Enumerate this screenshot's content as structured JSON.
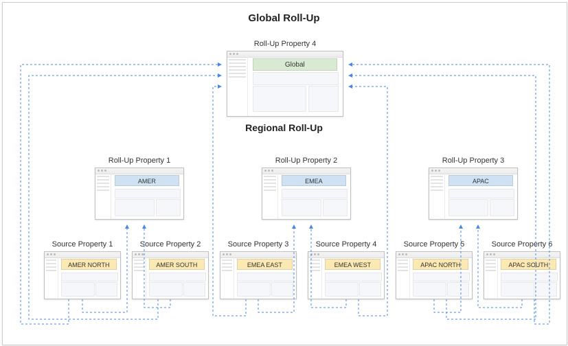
{
  "titles": {
    "global": "Global Roll-Up",
    "regional": "Regional Roll-Up"
  },
  "labels": {
    "rp1": "Roll-Up Property 1",
    "rp2": "Roll-Up Property 2",
    "rp3": "Roll-Up Property 3",
    "rp4": "Roll-Up Property 4",
    "sp1": "Source Property 1",
    "sp2": "Source Property 2",
    "sp3": "Source Property 3",
    "sp4": "Source Property 4",
    "sp5": "Source Property 5",
    "sp6": "Source Property 6"
  },
  "banners": {
    "global": "Global",
    "amer": "AMER",
    "emea": "EMEA",
    "apac": "APAC",
    "amer_north": "AMER NORTH",
    "amer_south": "AMER SOUTH",
    "emea_east": "EMEA EAST",
    "emea_west": "EMEA WEST",
    "apac_north": "APAC NORTH",
    "apac_south": "APAC SOUTH"
  },
  "colors": {
    "connector": "#4a86e8",
    "banner_global": "#d8ead3",
    "banner_region": "#cfe2f3",
    "banner_source": "#fce8b2"
  },
  "chart_data": {
    "type": "diagram",
    "nodes": [
      {
        "id": "rp4",
        "tier": "global",
        "label": "Roll-Up Property 4",
        "banner": "Global"
      },
      {
        "id": "rp1",
        "tier": "regional",
        "label": "Roll-Up Property 1",
        "banner": "AMER"
      },
      {
        "id": "rp2",
        "tier": "regional",
        "label": "Roll-Up Property 2",
        "banner": "EMEA"
      },
      {
        "id": "rp3",
        "tier": "regional",
        "label": "Roll-Up Property 3",
        "banner": "APAC"
      },
      {
        "id": "sp1",
        "tier": "source",
        "label": "Source Property 1",
        "banner": "AMER NORTH"
      },
      {
        "id": "sp2",
        "tier": "source",
        "label": "Source Property 2",
        "banner": "AMER SOUTH"
      },
      {
        "id": "sp3",
        "tier": "source",
        "label": "Source Property 3",
        "banner": "EMEA EAST"
      },
      {
        "id": "sp4",
        "tier": "source",
        "label": "Source Property 4",
        "banner": "EMEA WEST"
      },
      {
        "id": "sp5",
        "tier": "source",
        "label": "Source Property 5",
        "banner": "APAC NORTH"
      },
      {
        "id": "sp6",
        "tier": "source",
        "label": "Source Property 6",
        "banner": "APAC SOUTH"
      }
    ],
    "edges": [
      {
        "from": "sp1",
        "to": "rp1"
      },
      {
        "from": "sp2",
        "to": "rp1"
      },
      {
        "from": "sp3",
        "to": "rp2"
      },
      {
        "from": "sp4",
        "to": "rp2"
      },
      {
        "from": "sp5",
        "to": "rp3"
      },
      {
        "from": "sp6",
        "to": "rp3"
      },
      {
        "from": "sp1",
        "to": "rp4"
      },
      {
        "from": "sp2",
        "to": "rp4"
      },
      {
        "from": "sp3",
        "to": "rp4"
      },
      {
        "from": "sp4",
        "to": "rp4"
      },
      {
        "from": "sp5",
        "to": "rp4"
      },
      {
        "from": "sp6",
        "to": "rp4"
      }
    ]
  }
}
